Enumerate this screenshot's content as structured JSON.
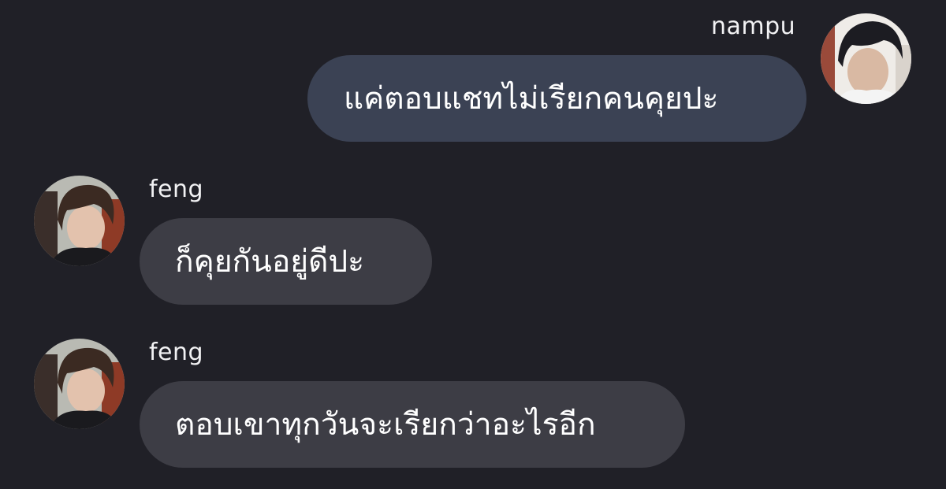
{
  "messages": [
    {
      "sender": "nampu",
      "side": "right",
      "text": "แค่ตอบแชทไม่เรียกคนคุยปะ",
      "avatar_icon": "user-avatar-nampu-icon"
    },
    {
      "sender": "feng",
      "side": "left",
      "text": "ก็คุยกันอยู่ดีปะ",
      "avatar_icon": "user-avatar-feng-icon"
    },
    {
      "sender": "feng",
      "side": "left",
      "text": "ตอบเขาทุกวันจะเรียกว่าอะไรอีก",
      "avatar_icon": "user-avatar-feng-icon"
    }
  ],
  "colors": {
    "background": "#202027",
    "outgoing_bubble": "#3b4254",
    "incoming_bubble": "#3d3d45",
    "text": "#ffffff"
  }
}
